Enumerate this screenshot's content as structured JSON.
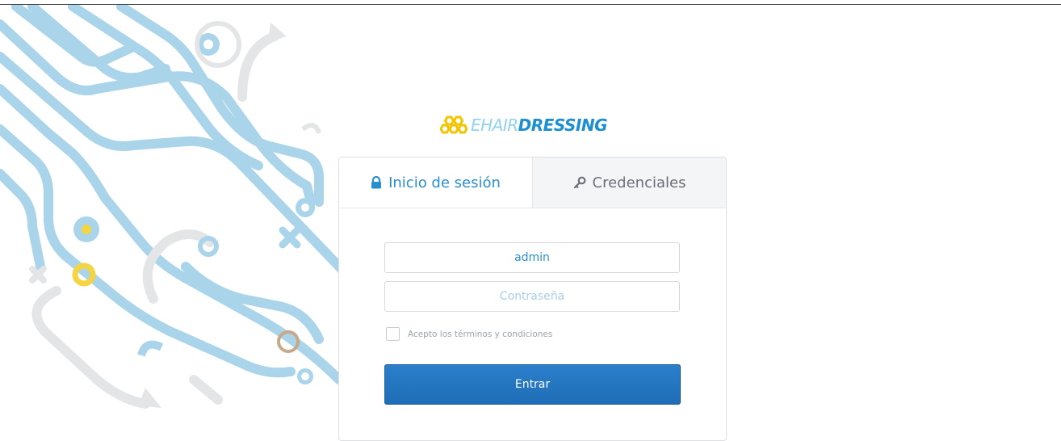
{
  "brand": {
    "light": "EHAIR",
    "bold": "DRESSING",
    "icon": "honeycomb-logo-icon",
    "colors": {
      "light": "#8fd3ef",
      "bold": "#1b8fd0",
      "icon": "#f2c500"
    }
  },
  "tabs": [
    {
      "label": "Inicio de sesión",
      "icon": "lock-icon",
      "active": true
    },
    {
      "label": "Credenciales",
      "icon": "key-icon",
      "active": false
    }
  ],
  "form": {
    "username_value": "admin",
    "password_placeholder": "Contraseña",
    "terms_label": "Acepto los términos y condiciones",
    "terms_checked": false,
    "submit_label": "Entrar"
  },
  "colors": {
    "accent": "#2a8fcf",
    "button": "#2176c0",
    "decor_blue": "#a9d4ea",
    "decor_grey": "#e3e5e7",
    "decor_yellow": "#f5d442"
  }
}
